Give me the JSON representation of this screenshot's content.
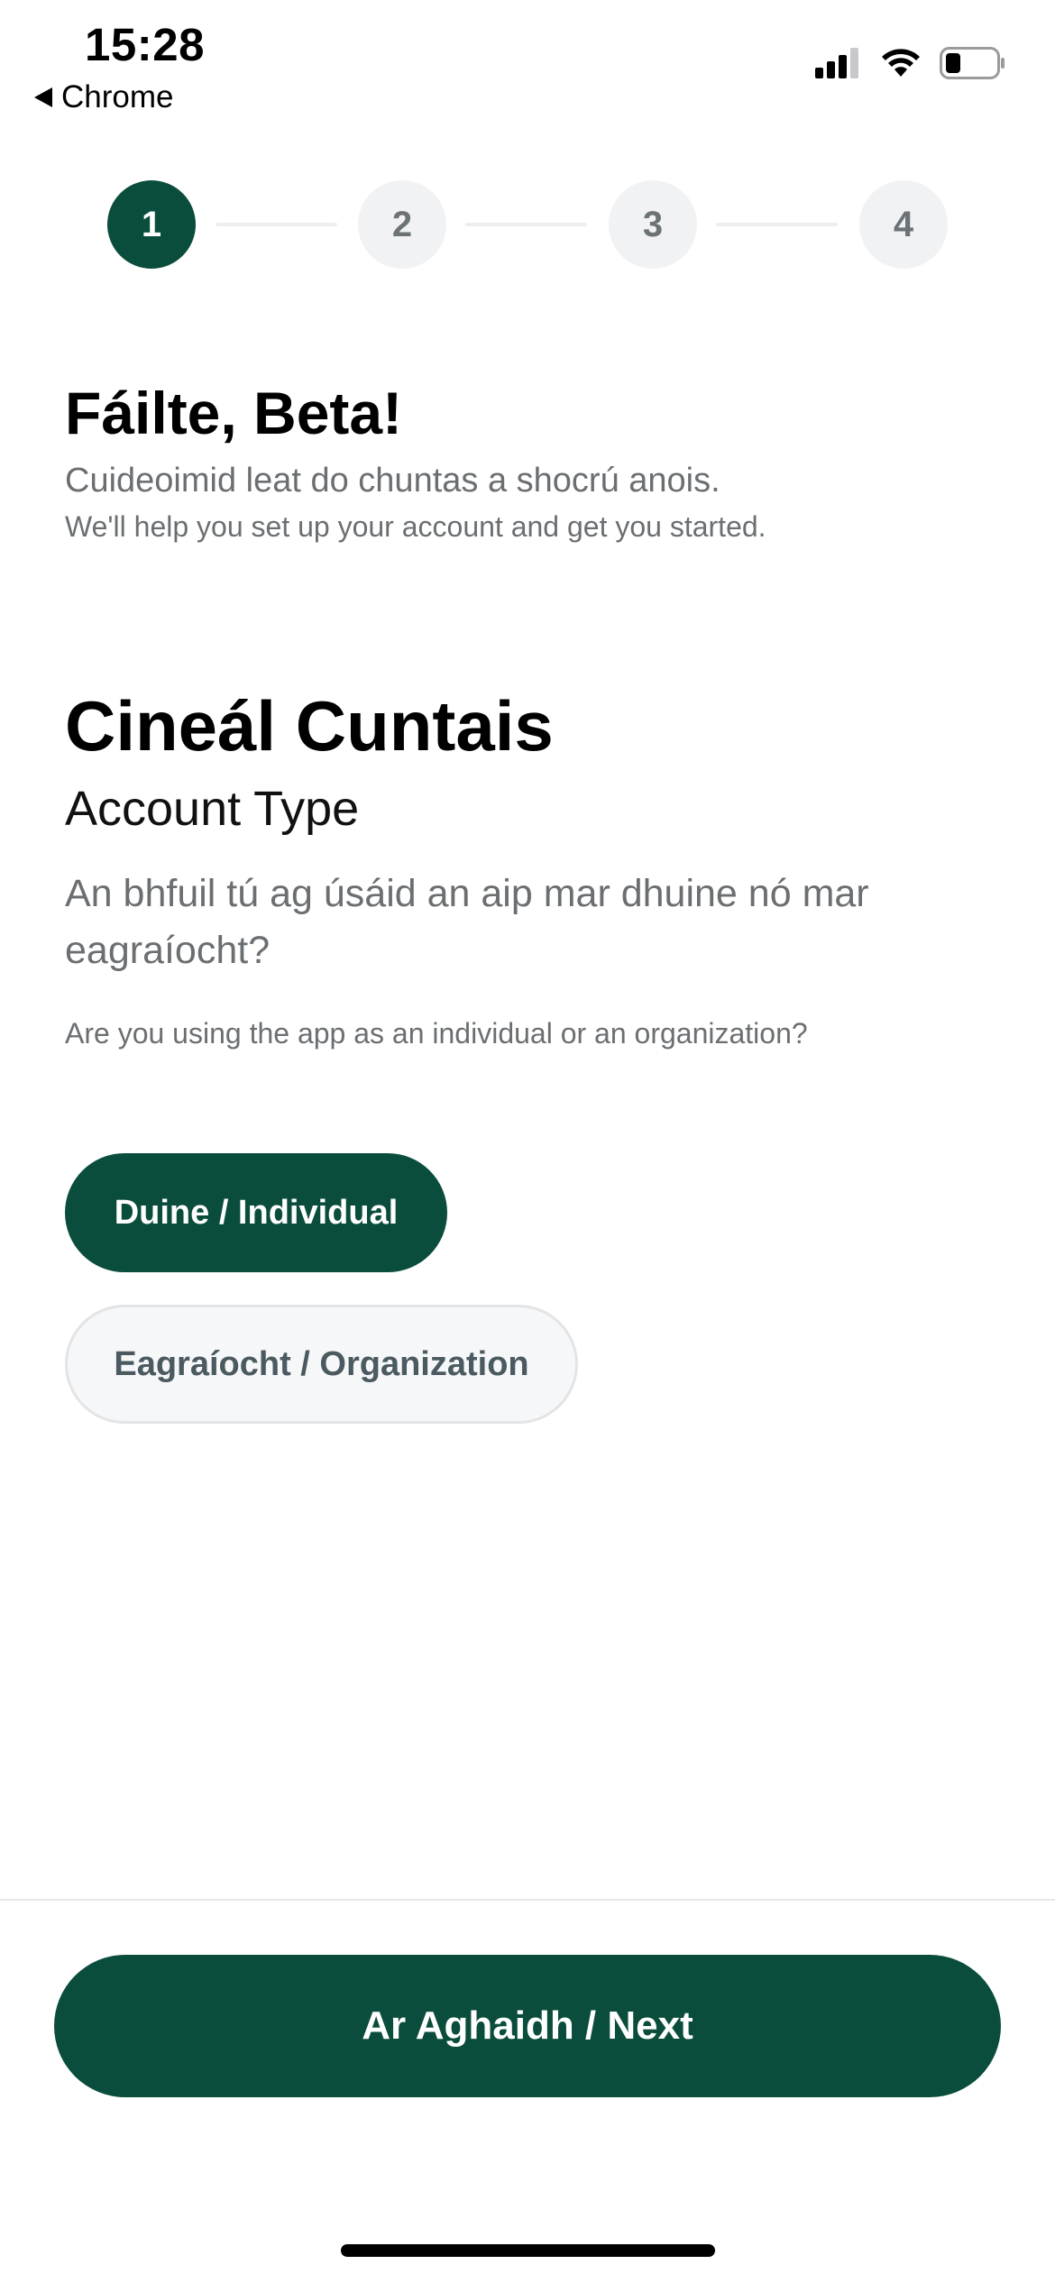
{
  "status_bar": {
    "time": "15:28",
    "back_app": "Chrome",
    "icons": [
      "cellular-signal-icon",
      "wifi-icon",
      "battery-icon"
    ]
  },
  "stepper": {
    "steps": [
      "1",
      "2",
      "3",
      "4"
    ],
    "current_step": 1
  },
  "welcome": {
    "title": "Fáilte, Beta!",
    "subtitle_ga": "Cuideoimid leat do chuntas a shocrú anois.",
    "subtitle_en": "We'll help you set up your account and get you started."
  },
  "account_type": {
    "title": "Cineál Cuntais",
    "subtitle": "Account Type",
    "question_ga": "An bhfuil tú ag úsáid an aip mar dhuine nó mar eagraíocht?",
    "question_en": "Are you using the app as an individual or an organization?",
    "options": [
      {
        "label": "Duine / Individual",
        "selected": true
      },
      {
        "label": "Eagraíocht / Organization",
        "selected": false
      }
    ]
  },
  "footer": {
    "next_label": "Ar Aghaidh / Next"
  },
  "colors": {
    "primary": "#0a4d3c",
    "inactive_step_bg": "#f1f2f4",
    "muted_text": "#6b6f72"
  }
}
